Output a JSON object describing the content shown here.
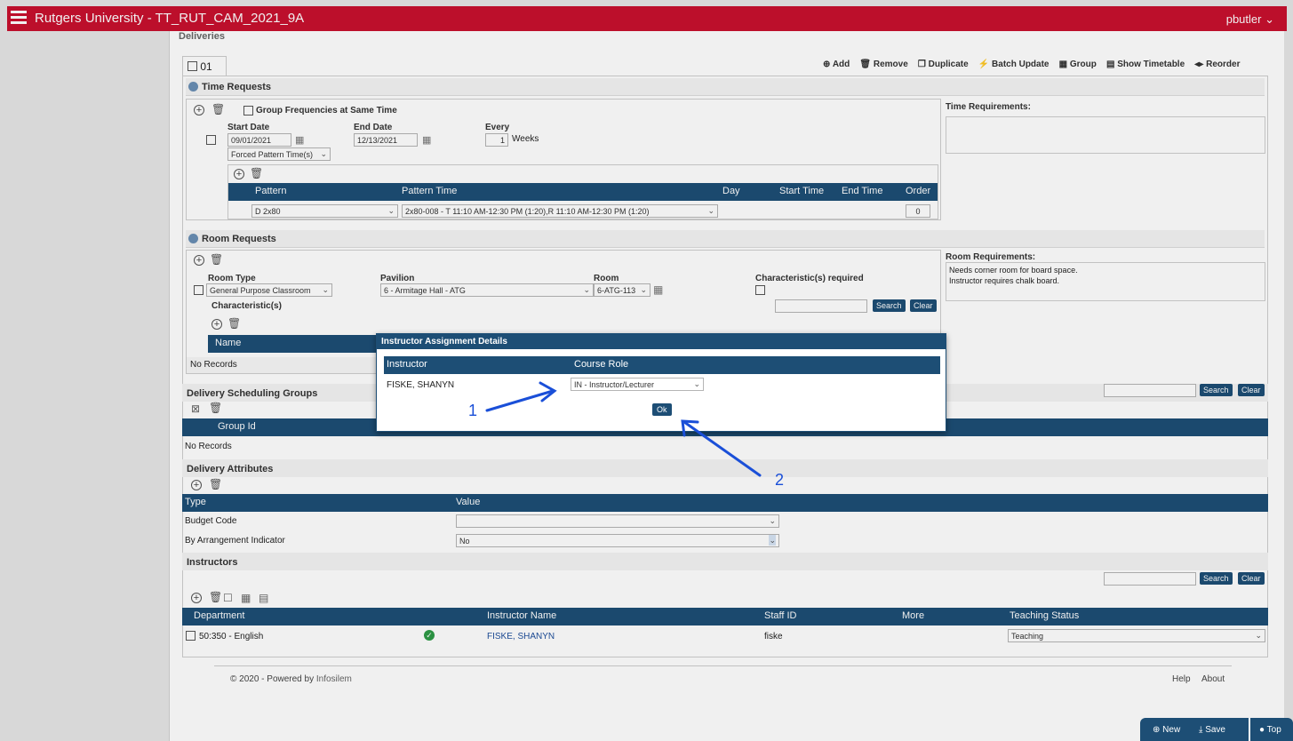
{
  "app": {
    "title": "Rutgers University - TT_RUT_CAM_2021_9A",
    "user": "pbutler"
  },
  "page": {
    "section_label": "Deliveries",
    "tab_label": "01"
  },
  "toolbar": {
    "add": "Add",
    "remove": "Remove",
    "duplicate": "Duplicate",
    "batch_update": "Batch Update",
    "group": "Group",
    "show_timetable": "Show Timetable",
    "reorder": "Reorder"
  },
  "time_requests": {
    "title": "Time Requests",
    "group_freq_label": "Group Frequencies at Same Time",
    "start_date_label": "Start Date",
    "start_date": "09/01/2021",
    "end_date_label": "End Date",
    "end_date": "12/13/2021",
    "every_label": "Every",
    "every_value": "1",
    "every_unit": "Weeks",
    "forced_pattern": "Forced Pattern Time(s)",
    "columns": [
      "Pattern",
      "Pattern Time",
      "Day",
      "Start Time",
      "End Time",
      "Order"
    ],
    "pattern_value": "D 2x80",
    "pattern_time_value": "2x80-008 - T 11:10 AM-12:30 PM (1:20),R 11:10 AM-12:30 PM (1:20)",
    "order_value": "0",
    "requirements_label": "Time Requirements:"
  },
  "room_requests": {
    "title": "Room Requests",
    "room_type_label": "Room Type",
    "room_type_value": "General Purpose Classroom",
    "pavilion_label": "Pavilion",
    "pavilion_value": "6 - Armitage Hall - ATG",
    "room_label": "Room",
    "room_value": "6-ATG-113",
    "char_required_label": "Characteristic(s) required",
    "characteristics_label": "Characteristic(s)",
    "search": "Search",
    "clear": "Clear",
    "name_col": "Name",
    "no_records": "No Records",
    "requirements_label": "Room Requirements:",
    "requirements_text": "Needs corner room for board space.\nInstructor requires chalk board."
  },
  "scheduling_groups": {
    "title": "Delivery Scheduling Groups",
    "group_id_col": "Group Id",
    "no_records": "No Records",
    "search": "Search",
    "clear": "Clear"
  },
  "attributes": {
    "title": "Delivery Attributes",
    "type_col": "Type",
    "value_col": "Value",
    "rows": [
      {
        "type": "Budget Code",
        "value": ""
      },
      {
        "type": "By Arrangement Indicator",
        "value": "No"
      }
    ]
  },
  "instructors": {
    "title": "Instructors",
    "search": "Search",
    "clear": "Clear",
    "columns": [
      "Department",
      "",
      "Instructor Name",
      "Staff ID",
      "More",
      "Teaching Status"
    ],
    "row": {
      "department": "50:350 - English",
      "name": "FISKE, SHANYN",
      "staff_id": "fiske",
      "status": "Teaching"
    }
  },
  "dialog": {
    "title": "Instructor Assignment Details",
    "instructor_col": "Instructor",
    "role_col": "Course Role",
    "instructor_value": "FISKE, SHANYN",
    "role_value": "IN - Instructor/Lecturer",
    "ok": "Ok"
  },
  "annotations": {
    "one": "1",
    "two": "2",
    "color": "#1a4fd8"
  },
  "footer": {
    "powered_prefix": "© 2020 - Powered by ",
    "powered_brand": "Infosilem",
    "help": "Help",
    "about": "About"
  },
  "bottom_actions": {
    "new": "New",
    "save": "Save",
    "top": "Top"
  }
}
